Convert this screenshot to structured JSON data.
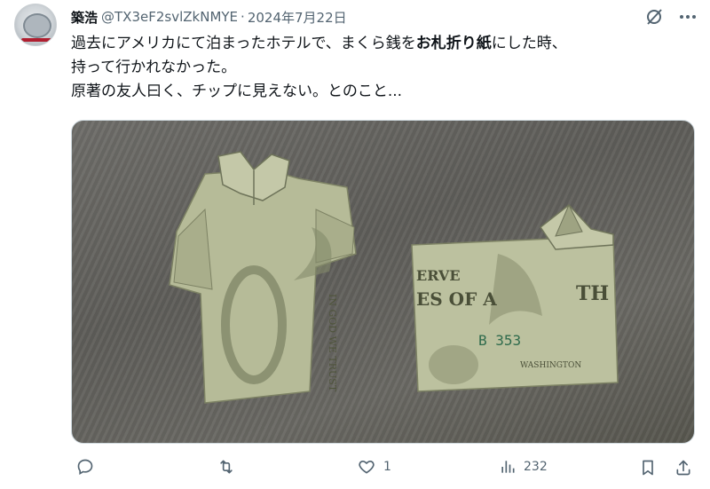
{
  "tweet": {
    "author_name": "築浩",
    "handle": "@TX3eF2svlZkNMYE",
    "separator": "·",
    "date": "2024年7月22日",
    "text": {
      "line1_a": "過去にアメリカにて泊まったホテルで、まくら銭を",
      "line1_bold": "お札折り紙",
      "line1_b": "にした時、",
      "line2": "持って行かれなかった。",
      "line3": "原著の友人曰く、チップに見えない。とのこと..."
    }
  },
  "photo": {
    "bill_text": {
      "in_god_we_trust": "IN GOD WE TRUST",
      "serial": "B 353",
      "washington": "WASHINGTON",
      "the": "TH",
      "states_of_a": "ES OF A",
      "serve": "ERVE"
    }
  },
  "actions": {
    "reply_count": "",
    "retweet_count": "",
    "like_count": "1",
    "views_count": "232"
  },
  "icons": {
    "grok": "grok-slash-icon",
    "more": "more-dots-icon",
    "reply": "reply-icon",
    "retweet": "retweet-icon",
    "like": "heart-icon",
    "views": "views-bar-icon",
    "bookmark": "bookmark-icon",
    "share": "share-icon"
  },
  "colors": {
    "text_primary": "#0f1419",
    "text_secondary": "#536471",
    "bill_green": "#b9bf9a"
  }
}
